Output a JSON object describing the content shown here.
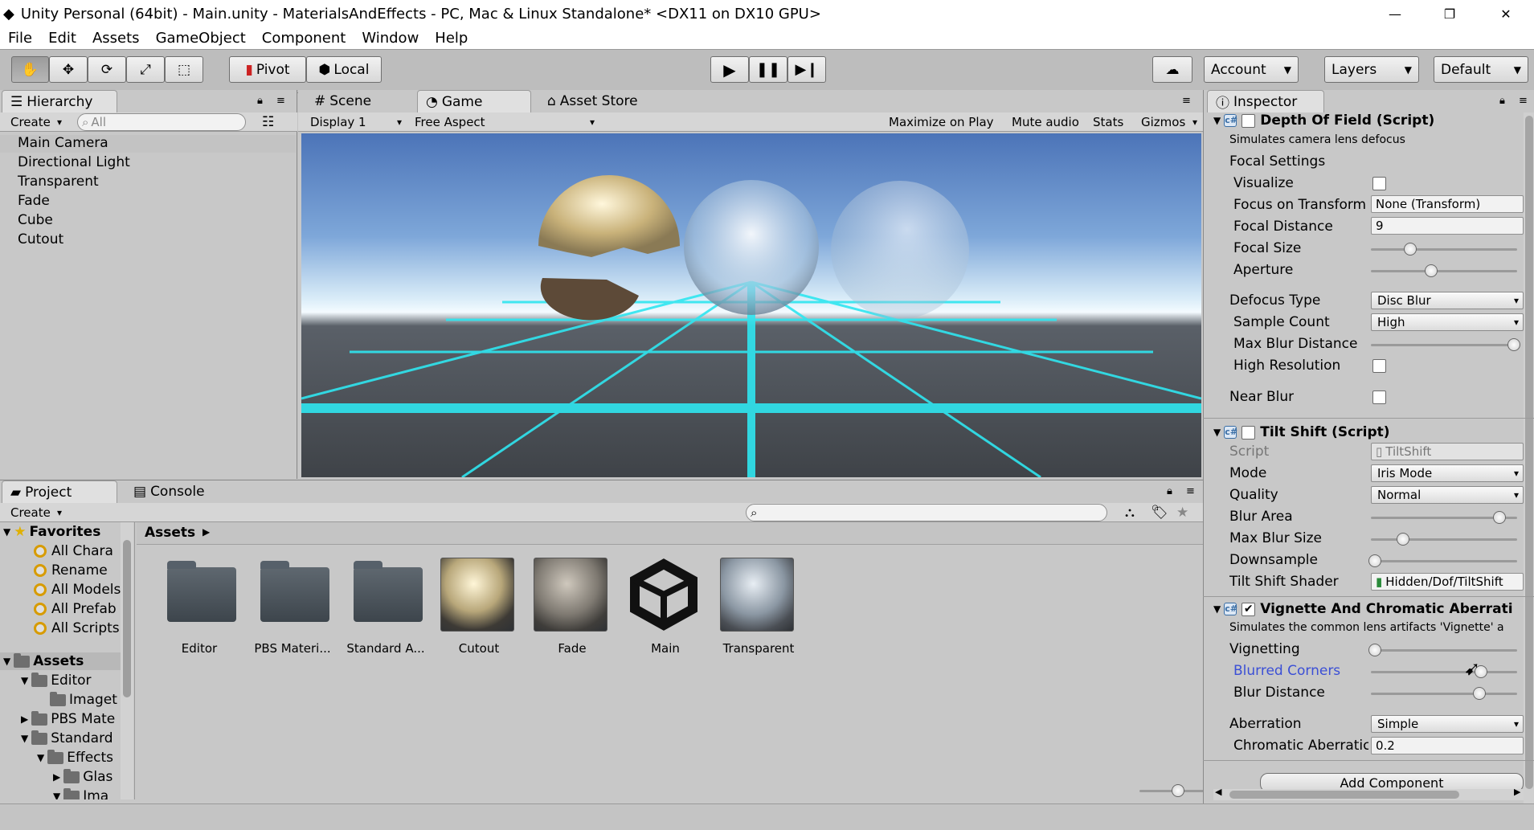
{
  "window": {
    "title": "Unity Personal (64bit) - Main.unity - MaterialsAndEffects - PC, Mac & Linux Standalone* <DX11 on DX10 GPU>",
    "minimize": "—",
    "restore": "❐",
    "close": "✕"
  },
  "menu": [
    "File",
    "Edit",
    "Assets",
    "GameObject",
    "Component",
    "Window",
    "Help"
  ],
  "toolbar": {
    "pivot": "Pivot",
    "local": "Local",
    "account": "Account",
    "layers": "Layers",
    "layout": "Default"
  },
  "hierarchy": {
    "tab": "Hierarchy",
    "create": "Create",
    "search_placeholder": "All",
    "items": [
      "Main Camera",
      "Directional Light",
      "Transparent",
      "Fade",
      "Cube",
      "Cutout"
    ]
  },
  "center_tabs": {
    "scene": "Scene",
    "game": "Game",
    "asset_store": "Asset Store"
  },
  "game_bar": {
    "display": "Display 1",
    "aspect": "Free Aspect",
    "maximize": "Maximize on Play",
    "mute": "Mute audio",
    "stats": "Stats",
    "gizmos": "Gizmos"
  },
  "project": {
    "tab": "Project",
    "console_tab": "Console",
    "create": "Create",
    "breadcrumb": "Assets",
    "favorites_label": "Favorites",
    "favorites": [
      "All Chara",
      "Rename",
      "All Models",
      "All Prefab",
      "All Scripts"
    ],
    "assets_label": "Assets",
    "tree": [
      "Editor",
      "Imaget",
      "PBS Mate",
      "Standard",
      "Effects",
      "Glas",
      "Ima"
    ],
    "assets": [
      {
        "name": "Editor",
        "kind": "folder"
      },
      {
        "name": "PBS Materi...",
        "kind": "folder"
      },
      {
        "name": "Standard A...",
        "kind": "folder"
      },
      {
        "name": "Cutout",
        "kind": "material"
      },
      {
        "name": "Fade",
        "kind": "material"
      },
      {
        "name": "Main",
        "kind": "unity"
      },
      {
        "name": "Transparent",
        "kind": "material"
      }
    ]
  },
  "inspector": {
    "tab": "Inspector",
    "dof": {
      "title": "Depth Of Field (Script)",
      "desc": "Simulates camera lens defocus",
      "focal_settings": "Focal Settings",
      "visualize": "Visualize",
      "focus_on_transform": "Focus on Transform",
      "focus_value": "None (Transform)",
      "focal_distance": "Focal Distance",
      "focal_distance_value": "9",
      "focal_size": "Focal Size",
      "focal_size_level": 0.27,
      "aperture": "Aperture",
      "aperture_level": 0.41,
      "defocus_type": "Defocus Type",
      "defocus_value": "Disc Blur",
      "sample_count": "Sample Count",
      "sample_value": "High",
      "max_blur": "Max Blur Distance",
      "max_blur_level": 0.98,
      "high_res": "High Resolution",
      "near_blur": "Near Blur"
    },
    "tilt": {
      "title": "Tilt Shift (Script)",
      "script": "Script",
      "script_value": "TiltShift",
      "mode": "Mode",
      "mode_value": "Iris Mode",
      "quality": "Quality",
      "quality_value": "Normal",
      "blur_area": "Blur Area",
      "blur_area_level": 0.88,
      "max_blur_size": "Max Blur Size",
      "max_blur_size_level": 0.22,
      "downsample": "Downsample",
      "downsample_level": 0.03,
      "shader": "Tilt Shift Shader",
      "shader_value": "Hidden/Dof/TiltShift"
    },
    "vignette": {
      "title": "Vignette And Chromatic Aberrati",
      "desc": "Simulates the common lens artifacts 'Vignette' a",
      "vignetting": "Vignetting",
      "vignetting_level": 0.03,
      "blurred_corners": "Blurred Corners",
      "blurred_corners_level": 0.75,
      "blur_distance": "Blur Distance",
      "blur_distance_level": 0.74,
      "aberration": "Aberration",
      "aberration_value": "Simple",
      "chromatic": "Chromatic Aberratic",
      "chromatic_value": "0.2"
    },
    "add_component": "Add Component"
  },
  "colors": {
    "accent_link": "#3b4fd6",
    "selection": "#c3c3c3",
    "grid_glow": "#2fe6f0"
  }
}
